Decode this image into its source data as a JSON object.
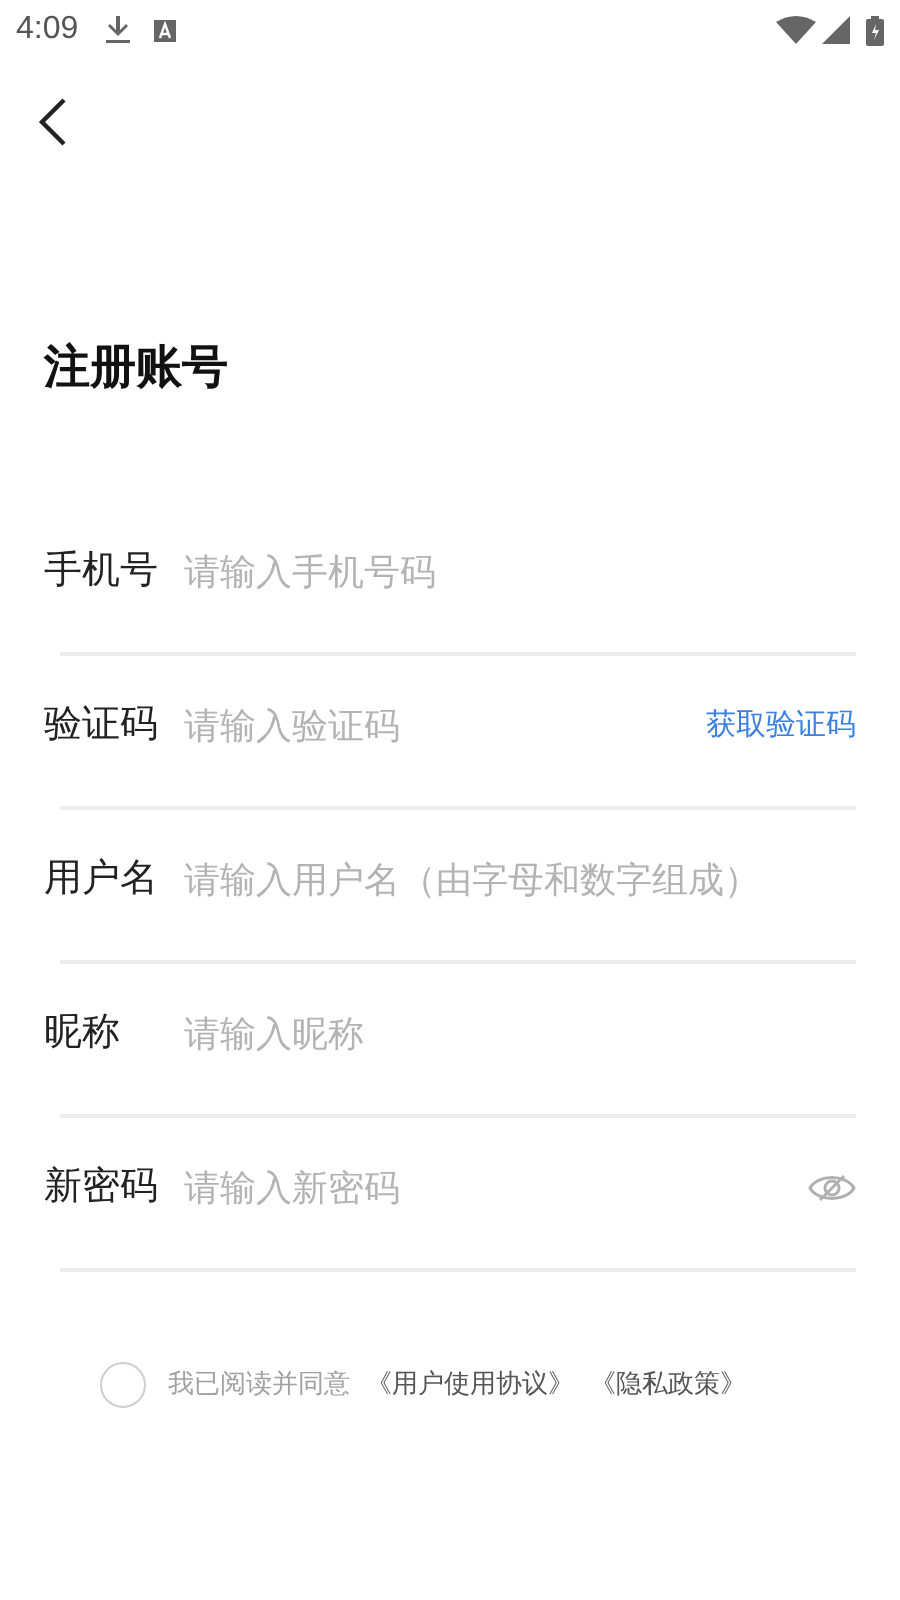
{
  "status_bar": {
    "time": "4:09"
  },
  "title": "注册账号",
  "fields": [
    {
      "kind": "text",
      "label": "手机号",
      "placeholder": "请输入手机号码"
    },
    {
      "kind": "code",
      "label": "验证码",
      "placeholder": "请输入验证码",
      "action": "获取验证码"
    },
    {
      "kind": "text",
      "label": "用户名",
      "placeholder": "请输入用户名（由字母和数字组成）"
    },
    {
      "kind": "text",
      "label": "昵称",
      "placeholder": "请输入昵称"
    },
    {
      "kind": "password",
      "label": "新密码",
      "placeholder": "请输入新密码"
    }
  ],
  "agreement": {
    "checked": false,
    "text": "我已阅读并同意",
    "links": [
      "《用户使用协议》",
      "《隐私政策》"
    ]
  }
}
